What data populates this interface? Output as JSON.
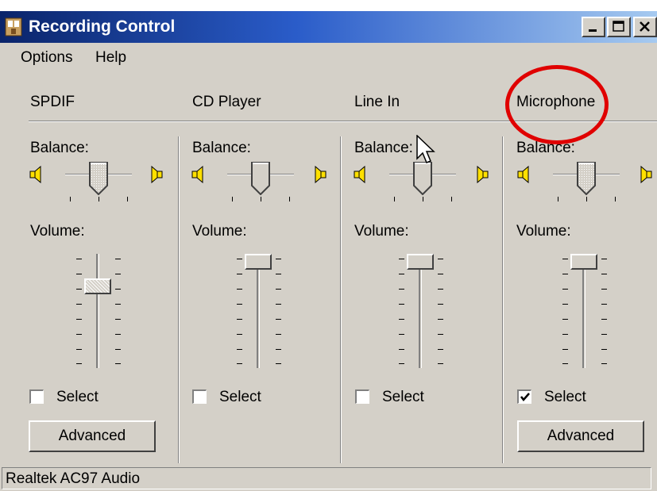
{
  "window": {
    "title": "Recording Control",
    "controls": [
      "minimize-icon",
      "maximize-icon",
      "close-icon"
    ]
  },
  "menu": {
    "items": [
      "Options",
      "Help"
    ]
  },
  "labels": {
    "balance": "Balance:",
    "volume": "Volume:",
    "select": "Select",
    "advanced": "Advanced"
  },
  "columns": [
    {
      "title": "SPDIF",
      "select_checked": false,
      "has_advanced": true,
      "volume_level": 0.75,
      "balance": 0.5
    },
    {
      "title": "CD Player",
      "select_checked": false,
      "has_advanced": false,
      "volume_level": 1.0,
      "balance": 0.5
    },
    {
      "title": "Line In",
      "select_checked": false,
      "has_advanced": false,
      "volume_level": 1.0,
      "balance": 0.5
    },
    {
      "title": "Microphone",
      "select_checked": true,
      "has_advanced": true,
      "volume_level": 1.0,
      "balance": 0.5
    }
  ],
  "status": {
    "text": "Realtek AC97 Audio"
  },
  "annotation": {
    "color": "#e00000",
    "target": "Microphone"
  },
  "colors": {
    "titlebar": "#0a246a",
    "face": "#d4d0c8"
  }
}
